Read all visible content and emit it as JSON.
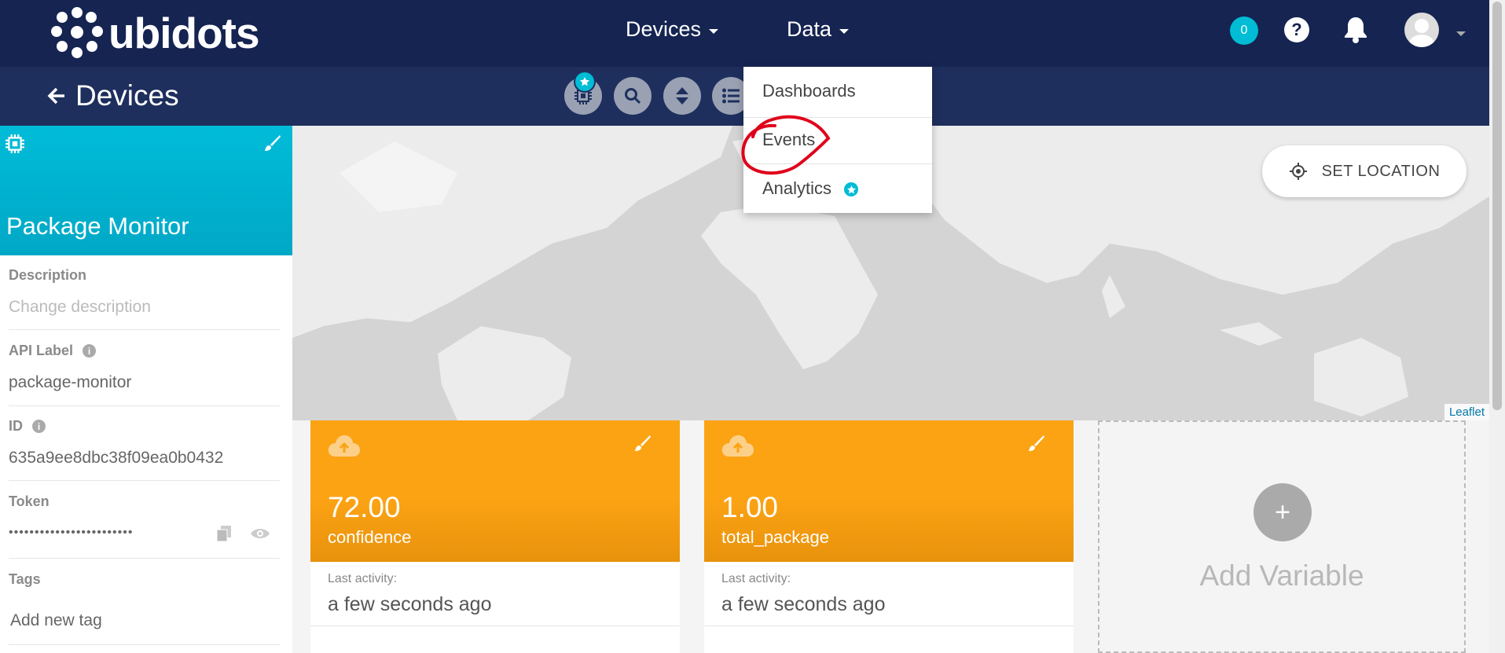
{
  "brand": {
    "name": "ubidots"
  },
  "nav": {
    "devices_label": "Devices",
    "data_label": "Data",
    "notification_count": "0",
    "help_symbol": "?"
  },
  "subheader": {
    "title": "Devices"
  },
  "data_menu": {
    "items": [
      {
        "label": "Dashboards"
      },
      {
        "label": "Events",
        "highlighted": true
      },
      {
        "label": "Analytics",
        "has_star": true
      }
    ]
  },
  "map": {
    "set_location_label": "SET LOCATION",
    "attribution": "Leaflet"
  },
  "device": {
    "name": "Package Monitor",
    "description_label": "Description",
    "description_placeholder": "Change description",
    "api_label_label": "API Label",
    "api_label_value": "package-monitor",
    "id_label": "ID",
    "id_value": "635a9ee8dbc38f09ea0b0432",
    "token_label": "Token",
    "token_value": "••••••••••••••••••••••••",
    "tags_label": "Tags",
    "tags_placeholder": "Add new tag"
  },
  "variables": [
    {
      "value": "72.00",
      "name": "confidence",
      "last_activity_label": "Last activity:",
      "last_activity": "a few seconds ago"
    },
    {
      "value": "1.00",
      "name": "total_package",
      "last_activity_label": "Last activity:",
      "last_activity": "a few seconds ago"
    }
  ],
  "add_variable": {
    "plus": "+",
    "label": "Add Variable"
  },
  "colors": {
    "topbar": "#152451",
    "subbar": "#1e2f5e",
    "accent_cyan": "#00bcd4",
    "variable_orange": "#fca314",
    "annotation_red": "#e0001a"
  }
}
